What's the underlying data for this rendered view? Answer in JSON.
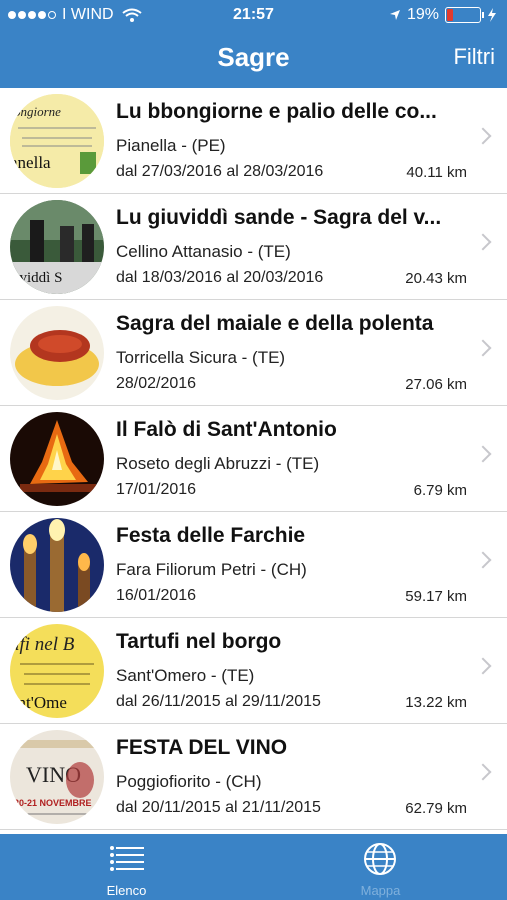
{
  "status_bar": {
    "carrier": "I WIND",
    "time": "21:57",
    "battery": "19%",
    "battery_level": 0.19
  },
  "navbar": {
    "title": "Sagre",
    "filter_label": "Filtri"
  },
  "colors": {
    "brand": "#3a83c6",
    "battery_low": "#e23b2e"
  },
  "events": [
    {
      "title": "Lu bbongiorne e palio delle co...",
      "place": "Pianella - (PE)",
      "dates": "dal 27/03/2016 al 28/03/2016",
      "distance": "40.11 km",
      "thumb_text": "ongiorne",
      "thumb_text2": "anella"
    },
    {
      "title": "Lu giuviddì sande - Sagra del v...",
      "place": "Cellino Attanasio - (TE)",
      "dates": "dal 18/03/2016 al 20/03/2016",
      "distance": "20.43 km",
      "thumb_text": "uviddì S",
      "thumb_text2": ""
    },
    {
      "title": "Sagra del maiale e della polenta",
      "place": "Torricella Sicura - (TE)",
      "dates": "28/02/2016",
      "distance": "27.06 km",
      "thumb_text": "",
      "thumb_text2": ""
    },
    {
      "title": "Il Falò di Sant'Antonio",
      "place": "Roseto degli Abruzzi - (TE)",
      "dates": "17/01/2016",
      "distance": "6.79 km",
      "thumb_text": "",
      "thumb_text2": ""
    },
    {
      "title": "Festa delle Farchie",
      "place": "Fara Filiorum Petri - (CH)",
      "dates": "16/01/2016",
      "distance": "59.17 km",
      "thumb_text": "",
      "thumb_text2": ""
    },
    {
      "title": "Tartufi nel borgo",
      "place": "Sant'Omero - (TE)",
      "dates": "dal 26/11/2015 al 29/11/2015",
      "distance": "13.22 km",
      "thumb_text": "ufi nel B",
      "thumb_text2": "ant'Ome"
    },
    {
      "title": "FESTA DEL VINO",
      "place": "Poggiofiorito - (CH)",
      "dates": "dal 20/11/2015 al 21/11/2015",
      "distance": "62.79 km",
      "thumb_text": "VINO",
      "thumb_text2": "20-21 NOVEMBRE"
    }
  ],
  "tabs": [
    {
      "label": "Elenco",
      "icon": "list-icon",
      "active": true
    },
    {
      "label": "Mappa",
      "icon": "globe-icon",
      "active": false
    }
  ]
}
